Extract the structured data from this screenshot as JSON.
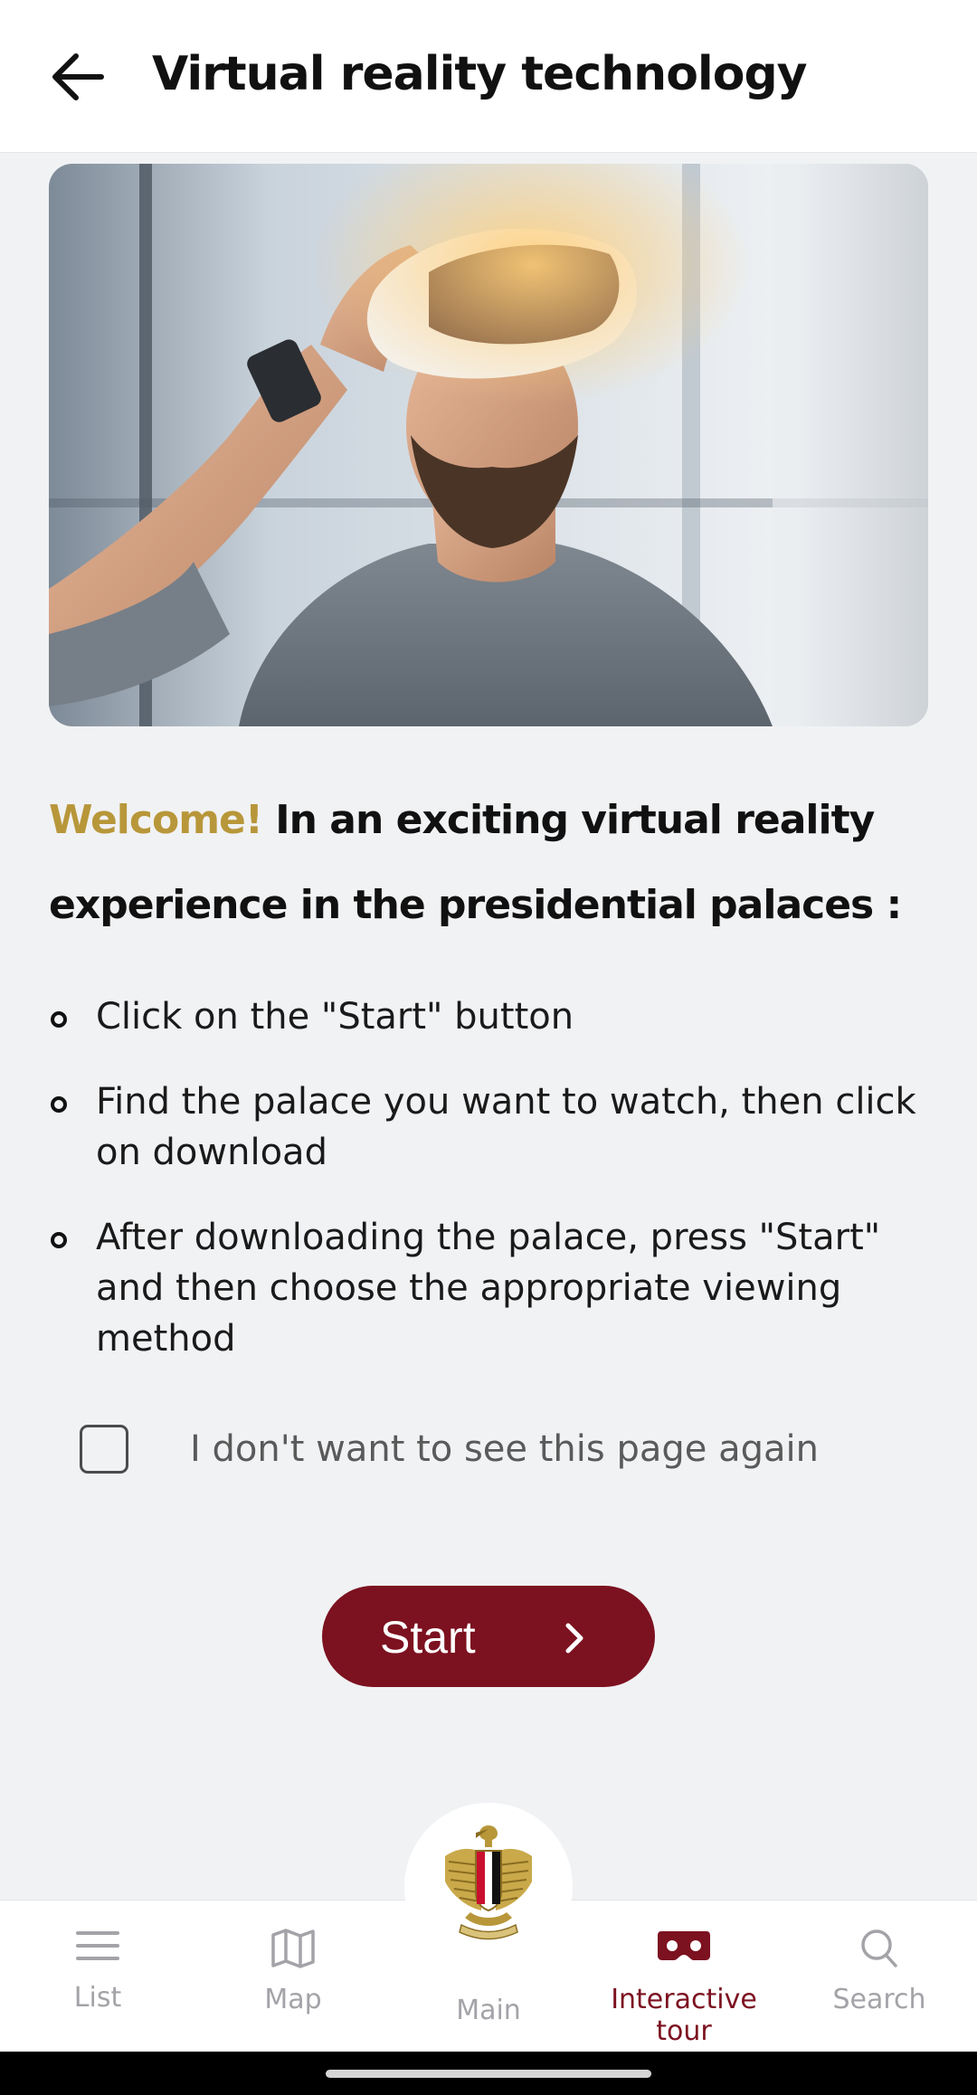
{
  "header": {
    "title": "Virtual reality technology"
  },
  "intro": {
    "welcome_word": "Welcome!",
    "welcome_rest": " In an exciting virtual reality experience in the presidential palaces :"
  },
  "steps": [
    "Click on the \"Start\" button",
    "Find the palace you want to watch, then click on download",
    "After downloading the palace, press \"Start\" and then choose the appropriate viewing method"
  ],
  "optout": {
    "label": "I don't want to see this page again",
    "checked": false
  },
  "start_button": {
    "label": "Start"
  },
  "bottom_nav": {
    "items": [
      {
        "label": "List",
        "icon": "list-icon"
      },
      {
        "label": "Map",
        "icon": "map-icon"
      },
      {
        "label": "Main",
        "icon": "emblem-icon"
      },
      {
        "label": "Interactive tour",
        "icon": "vr-headset-icon",
        "active": true
      },
      {
        "label": "Search",
        "icon": "search-icon"
      }
    ]
  },
  "colors": {
    "accent_gold": "#b8973a",
    "brand_maroon": "#7c1120",
    "nav_inactive": "#a3a3a8",
    "background": "#f1f2f4"
  }
}
